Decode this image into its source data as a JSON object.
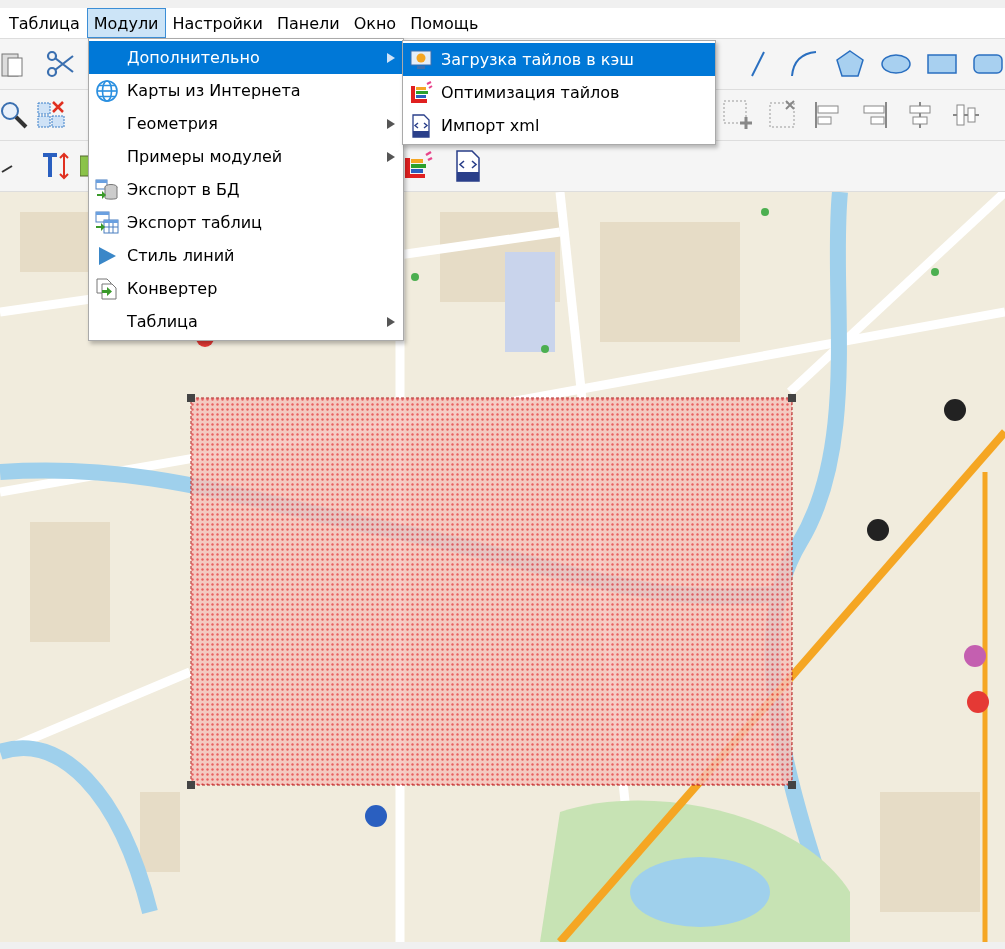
{
  "menu_bar": [
    {
      "label": "Таблица",
      "selected": false
    },
    {
      "label": "Модули",
      "selected": true
    },
    {
      "label": "Настройки",
      "selected": false
    },
    {
      "label": "Панели",
      "selected": false
    },
    {
      "label": "Окно",
      "selected": false
    },
    {
      "label": "Помощь",
      "selected": false
    }
  ],
  "modules_menu": [
    {
      "label": "Дополнительно",
      "submenu": true,
      "selected": true
    },
    {
      "label": "Карты из Интернета",
      "submenu": false,
      "selected": false
    },
    {
      "label": "Геометрия",
      "submenu": true,
      "selected": false
    },
    {
      "label": "Примеры модулей",
      "submenu": true,
      "selected": false
    },
    {
      "label": "Экспорт в БД",
      "submenu": false,
      "selected": false
    },
    {
      "label": "Экспорт таблиц",
      "submenu": false,
      "selected": false
    },
    {
      "label": "Стиль линий",
      "submenu": false,
      "selected": false
    },
    {
      "label": "Конвертер",
      "submenu": false,
      "selected": false
    },
    {
      "label": "Таблица",
      "submenu": true,
      "selected": false
    }
  ],
  "submenu": [
    {
      "label": "Загрузка тайлов в кэш",
      "selected": true
    },
    {
      "label": "Оптимизация тайлов",
      "selected": false
    },
    {
      "label": "Импорт xml",
      "selected": false
    }
  ]
}
